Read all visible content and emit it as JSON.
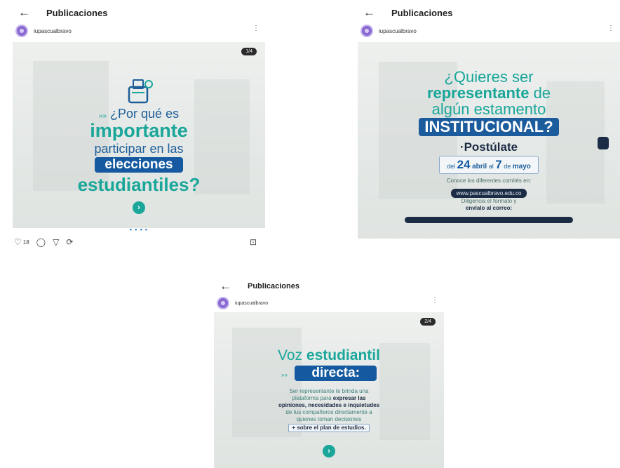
{
  "screens": [
    {
      "header": {
        "back_glyph": "←",
        "title": "Publicaciones"
      },
      "user": {
        "name": "iupascualbravo",
        "more": "⋮"
      },
      "counter": "1/4",
      "post": {
        "marker": "»»",
        "line1": "¿Por qué es",
        "line2": "importante",
        "line3": "participar en las",
        "line4": "elecciones",
        "line5": "estudiantiles?",
        "next": "›"
      },
      "actions": {
        "like": "♡",
        "likes": "18",
        "comment": "◯",
        "share": "▽",
        "repost": "⟳",
        "save": "⊡"
      },
      "dots": "● ● ● ●"
    },
    {
      "header": {
        "back_glyph": "←",
        "title": "Publicaciones"
      },
      "user": {
        "name": "iupascualbravo",
        "more": "⋮"
      },
      "post": {
        "q1": "¿Quieres ser",
        "q2a": "representante",
        "q2b": " de",
        "q3": "algún estamento",
        "q4": "INSTITUCIONAL?",
        "postulate": "·Postúlate",
        "del": "del",
        "day1": "24",
        "m1": "abril",
        "al": "al",
        "day2": "7",
        "de": "de",
        "m2": "mayo",
        "conoce": "Conoce los diferentes comités en:",
        "web": "www.pascualbravo.edu.co",
        "dil1": "Diligencia el formato y",
        "dil2": "envíalo al correo:"
      }
    },
    {
      "header": {
        "back_glyph": "←",
        "title": "Publicaciones"
      },
      "user": {
        "name": "iupascualbravo",
        "more": "⋮"
      },
      "counter": "2/4",
      "post": {
        "t1a": "Voz ",
        "t1b": "estudiantil",
        "t2": "directa:",
        "marker": "»»",
        "b1": "Ser representante te brinda una",
        "b2a": "plataforma para ",
        "b2b": "expresar las",
        "b3": "opiniones, necesidades e inquietudes",
        "b4": "de tus compañeros directamente a",
        "b5": "quienes toman decisiones",
        "b6": "+ sobre el plan de estudios.",
        "next": "›"
      }
    }
  ]
}
